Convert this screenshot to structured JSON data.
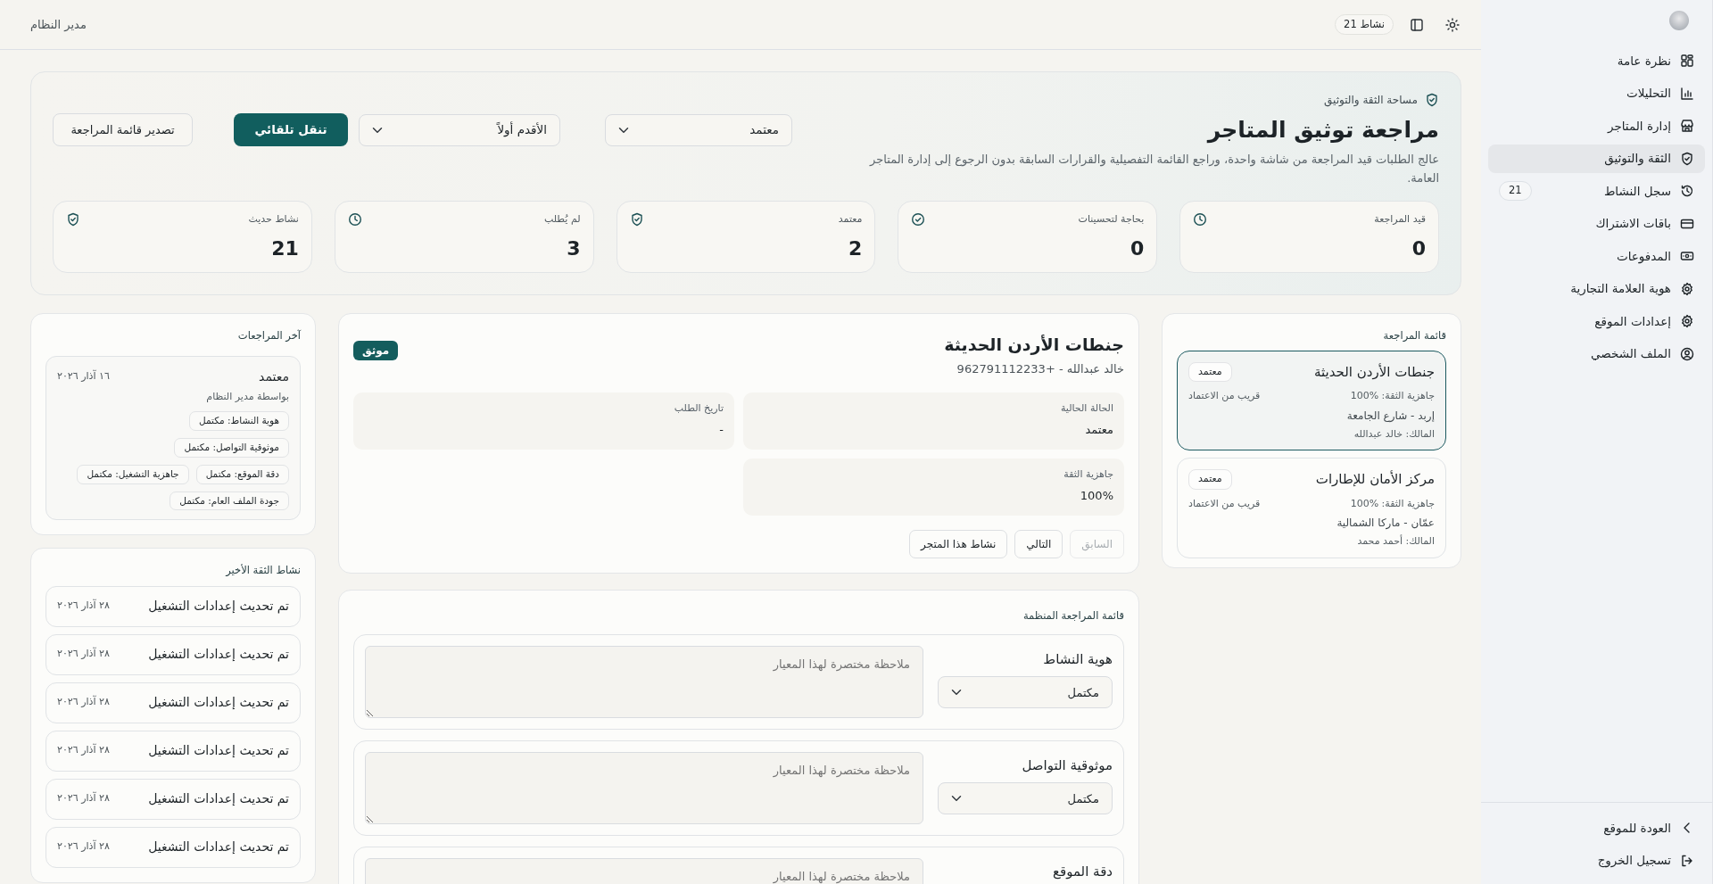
{
  "sidebar": {
    "items": [
      {
        "label": "نظرة عامة",
        "selected": false
      },
      {
        "label": "التحليلات",
        "selected": false
      },
      {
        "label": "إدارة المتاجر",
        "selected": false
      },
      {
        "label": "الثقة والتوثيق",
        "selected": true
      },
      {
        "label": "سجل النشاط",
        "selected": false,
        "badge": "21"
      },
      {
        "label": "باقات الاشتراك",
        "selected": false
      },
      {
        "label": "المدفوعات",
        "selected": false
      },
      {
        "label": "هوية العلامة التجارية",
        "selected": false
      },
      {
        "label": "إعدادات الموقع",
        "selected": false
      },
      {
        "label": "الملف الشخصي",
        "selected": false
      }
    ],
    "footer_items": [
      {
        "label": "العودة للموقع"
      },
      {
        "label": "تسجيل الخروج"
      }
    ]
  },
  "header": {
    "title": "مدير النظام",
    "activity_badge": "نشاط 21"
  },
  "hero": {
    "eyebrow": "مساحة الثقة والتوثيق",
    "title": "مراجعة توثيق المتاجر",
    "description": "عالج الطلبات قيد المراجعة من شاشة واحدة، وراجع القائمة التفصيلية والقرارات السابقة بدون الرجوع إلى إدارة المتاجر العامة.",
    "status_filter": "معتمد",
    "sort_select": "الأقدم أولاً",
    "auto_button": "تنقل تلقائي",
    "export_button": "تصدير قائمة المراجعة",
    "stats": [
      {
        "label": "قيد المراجعة",
        "value": "0"
      },
      {
        "label": "بحاجة لتحسينات",
        "value": "0"
      },
      {
        "label": "معتمد",
        "value": "2"
      },
      {
        "label": "لم يُطلب",
        "value": "3"
      },
      {
        "label": "نشاط حديث",
        "value": "21"
      }
    ]
  },
  "review_queue": {
    "title": "قائمة المراجعة",
    "items": [
      {
        "name": "جنطات الأردن الحديثة",
        "status": "معتمد",
        "readiness": "جاهزية الثقة: %100",
        "note": "قريب من الاعتماد",
        "location": "إربد - شارع الجامعة",
        "owner": "المالك: خالد عبدالله",
        "selected": true
      },
      {
        "name": "مركز الأمان للإطارات",
        "status": "معتمد",
        "readiness": "جاهزية الثقة: %100",
        "note": "قريب من الاعتماد",
        "location": "عمّان - ماركا الشمالية",
        "owner": "المالك: أحمد محمد",
        "selected": false
      }
    ]
  },
  "store": {
    "name": "جنطات الأردن الحديثة",
    "contact": "خالد عبدالله - +962791112233",
    "verified_badge": "موثق",
    "fields": [
      {
        "label": "الحالة الحالية",
        "value": "معتمد"
      },
      {
        "label": "تاريخ الطلب",
        "value": "-"
      },
      {
        "label": "جاهزية الثقة",
        "value": "100%"
      }
    ],
    "buttons": [
      {
        "label": "السابق",
        "disabled": true
      },
      {
        "label": "التالي",
        "disabled": false
      },
      {
        "label": "نشاط هذا المتجر",
        "disabled": false
      }
    ]
  },
  "checklist": {
    "title": "قائمة المراجعة المنظمة",
    "items": [
      {
        "label": "هوية النشاط",
        "value": "مكتمل",
        "placeholder": "ملاحظة مختصرة لهذا المعيار"
      },
      {
        "label": "موثوقية التواصل",
        "value": "مكتمل",
        "placeholder": "ملاحظة مختصرة لهذا المعيار"
      },
      {
        "label": "دقة الموقع",
        "placeholder": "ملاحظة مختصرة لهذا المعيار"
      }
    ]
  },
  "recent_reviews": {
    "title": "آخر المراجعات",
    "items": [
      {
        "status": "معتمد",
        "date": "١٦ آذار ٢٠٢٦",
        "by": "بواسطة مدير النظام",
        "tags": [
          "هوية النشاط: مكتمل",
          "موثوقية التواصل: مكتمل",
          "دقة الموقع: مكتمل",
          "جاهزية التشغيل: مكتمل",
          "جودة الملف العام: مكتمل"
        ]
      }
    ]
  },
  "trust_activity": {
    "title": "نشاط الثقة الأخير",
    "items": [
      {
        "text": "تم تحديث إعدادات التشغيل",
        "date": "٢٨ آذار ٢٠٢٦"
      },
      {
        "text": "تم تحديث إعدادات التشغيل",
        "date": "٢٨ آذار ٢٠٢٦"
      },
      {
        "text": "تم تحديث إعدادات التشغيل",
        "date": "٢٨ آذار ٢٠٢٦"
      },
      {
        "text": "تم تحديث إعدادات التشغيل",
        "date": "٢٨ آذار ٢٠٢٦"
      },
      {
        "text": "تم تحديث إعدادات التشغيل",
        "date": "٢٨ آذار ٢٠٢٦"
      },
      {
        "text": "تم تحديث إعدادات التشغيل",
        "date": "٢٨ آذار ٢٠٢٦"
      }
    ]
  }
}
